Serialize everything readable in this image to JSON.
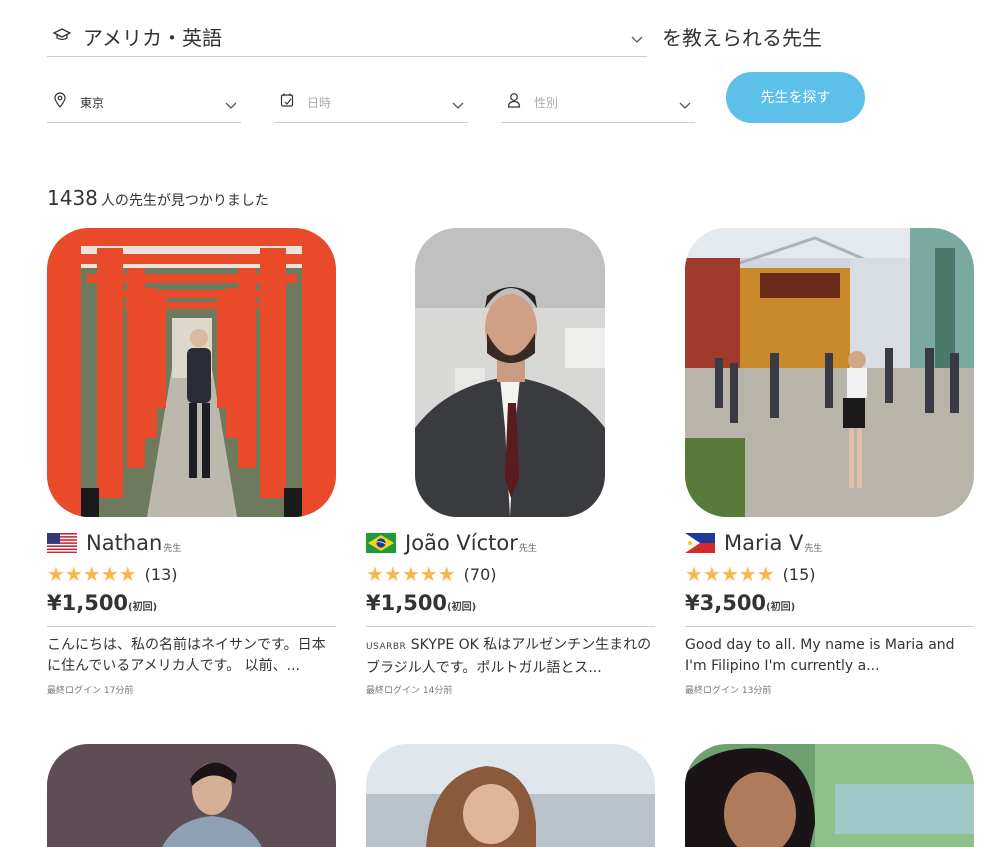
{
  "search": {
    "subject": "アメリカ・英語",
    "suffix": "を教えられる先生",
    "location": "東京",
    "date_placeholder": "日時",
    "gender_placeholder": "性別",
    "button": "先生を探す"
  },
  "results": {
    "count": "1438",
    "count_suffix": "人の先生が見つかりました"
  },
  "honorific": "先生",
  "first_lesson": "(初回)",
  "stars": "★★★★★",
  "teachers": [
    {
      "name": "Nathan",
      "flag": "us",
      "reviews": "(13)",
      "price": "¥1,500",
      "intro": "こんにちは、私の名前はネイサンです。日本に住んでいるアメリカ人です。 以前、...",
      "intro_tag": "",
      "last_login": "最終ログイン 17分前"
    },
    {
      "name": "João Víctor",
      "flag": "br",
      "reviews": "(70)",
      "price": "¥1,500",
      "intro": "SKYPE OK 私はアルゼンチン生まれのブラジル人です。ポルトガル語とス...",
      "intro_tag": "USARBR",
      "last_login": "最終ログイン 14分前"
    },
    {
      "name": "Maria V",
      "flag": "ph",
      "reviews": "(15)",
      "price": "¥3,500",
      "intro": "Good day to all. My name is Maria and I'm Filipino I'm currently a...",
      "intro_tag": "",
      "last_login": "最終ログイン 13分前"
    }
  ],
  "colors": {
    "accent": "#5cc0e8",
    "star": "#f6b84a",
    "torii": "#e84a2a"
  }
}
